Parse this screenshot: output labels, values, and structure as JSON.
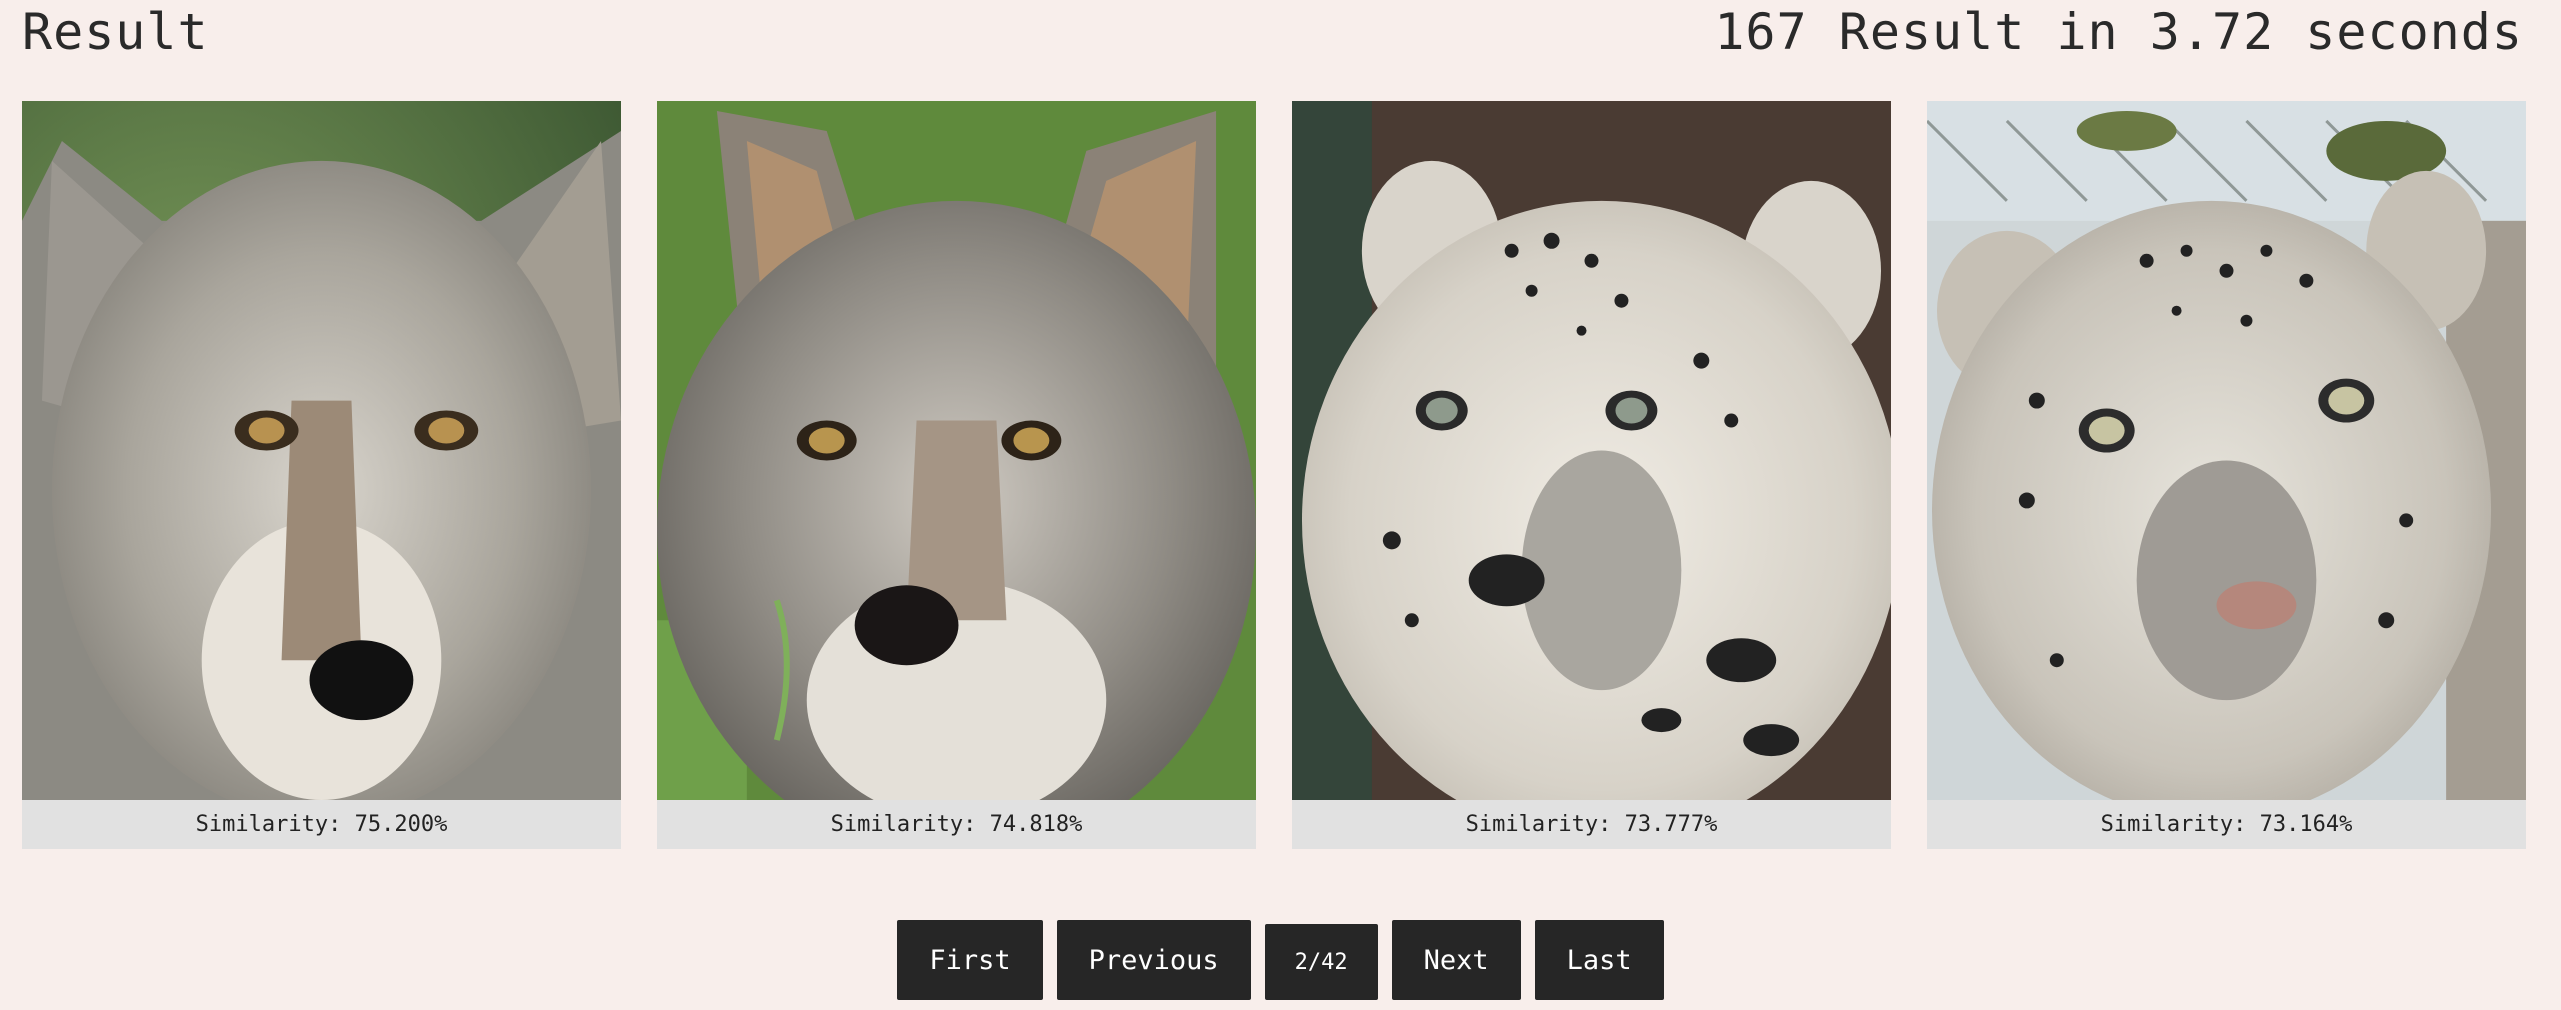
{
  "header": {
    "title": "Result",
    "stats": "167 Result in 3.72 seconds"
  },
  "results": [
    {
      "animal": "wolf",
      "similarity": "Similarity: 75.200%"
    },
    {
      "animal": "wolf",
      "similarity": "Similarity: 74.818%"
    },
    {
      "animal": "snow-leopard",
      "similarity": "Similarity: 73.777%"
    },
    {
      "animal": "snow-leopard",
      "similarity": "Similarity: 73.164%"
    }
  ],
  "pagination": {
    "first": "First",
    "previous": "Previous",
    "page": "2/42",
    "next": "Next",
    "last": "Last"
  },
  "colors": {
    "background": "#f8eeeb",
    "button": "#262626",
    "caption": "#e1e1e1"
  }
}
